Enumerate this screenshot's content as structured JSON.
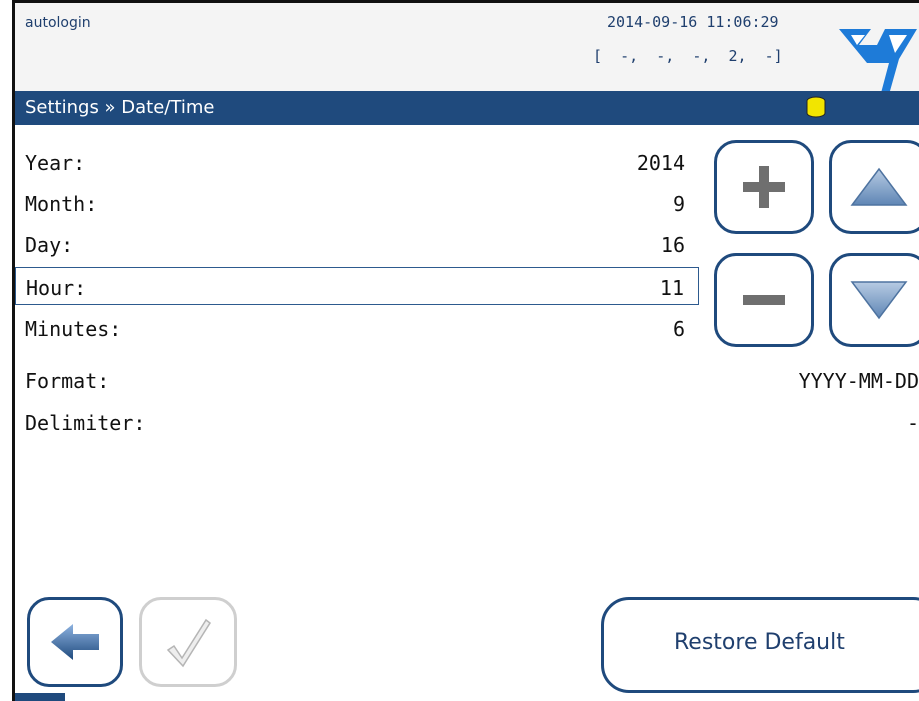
{
  "header": {
    "user": "autologin",
    "datetime": "2014-09-16 11:06:29",
    "status": "[  -,  -,  -,  2,  -]"
  },
  "titlebar": {
    "breadcrumb": "Settings » Date/Time"
  },
  "fields": {
    "year": {
      "label": "Year:",
      "value": "2014"
    },
    "month": {
      "label": "Month:",
      "value": "9"
    },
    "day": {
      "label": "Day:",
      "value": "16"
    },
    "hour": {
      "label": "Hour:",
      "value": "11"
    },
    "minutes": {
      "label": "Minutes:",
      "value": "6"
    },
    "format": {
      "label": "Format:",
      "value": "YYYY-MM-DD"
    },
    "delimiter": {
      "label": "Delimiter:",
      "value": "-"
    }
  },
  "buttons": {
    "restore_default": "Restore Default",
    "icons": {
      "increment": "plus-icon",
      "decrement": "minus-icon",
      "up": "up-arrow-icon",
      "down": "down-arrow-icon",
      "back": "back-arrow-icon",
      "confirm": "check-icon"
    }
  },
  "colors": {
    "accent": "#1f4a7d",
    "disabled": "#cfcfcf",
    "coin": "#f2e500",
    "logo": "#1e7bd8"
  }
}
